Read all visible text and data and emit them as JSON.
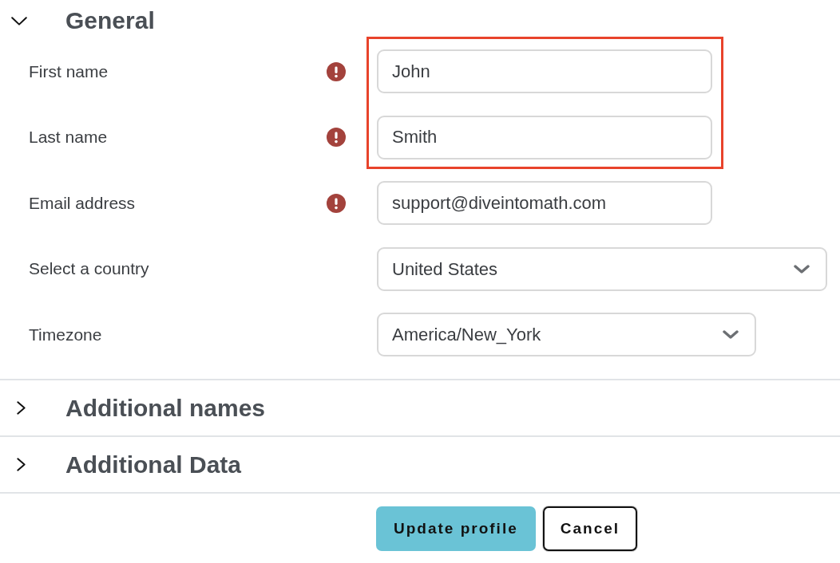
{
  "sections": [
    {
      "title": "General",
      "expanded": true,
      "fields": [
        {
          "kind": "text",
          "label": "First name",
          "value": "John",
          "required": true,
          "highlighted": true
        },
        {
          "kind": "text",
          "label": "Last name",
          "value": "Smith",
          "required": true,
          "highlighted": true
        },
        {
          "kind": "text",
          "label": "Email address",
          "value": "support@diveintomath.com",
          "required": true,
          "highlighted": false
        },
        {
          "kind": "select",
          "label": "Select a country",
          "value": "United States",
          "required": false,
          "highlighted": false
        },
        {
          "kind": "select",
          "label": "Timezone",
          "value": "America/New_York",
          "required": false,
          "highlighted": false
        }
      ]
    },
    {
      "title": "Additional names",
      "expanded": false
    },
    {
      "title": "Additional Data",
      "expanded": false
    }
  ],
  "buttons": [
    {
      "kind": "primary",
      "label": "Update profile"
    },
    {
      "kind": "secondary",
      "label": "Cancel"
    }
  ]
}
